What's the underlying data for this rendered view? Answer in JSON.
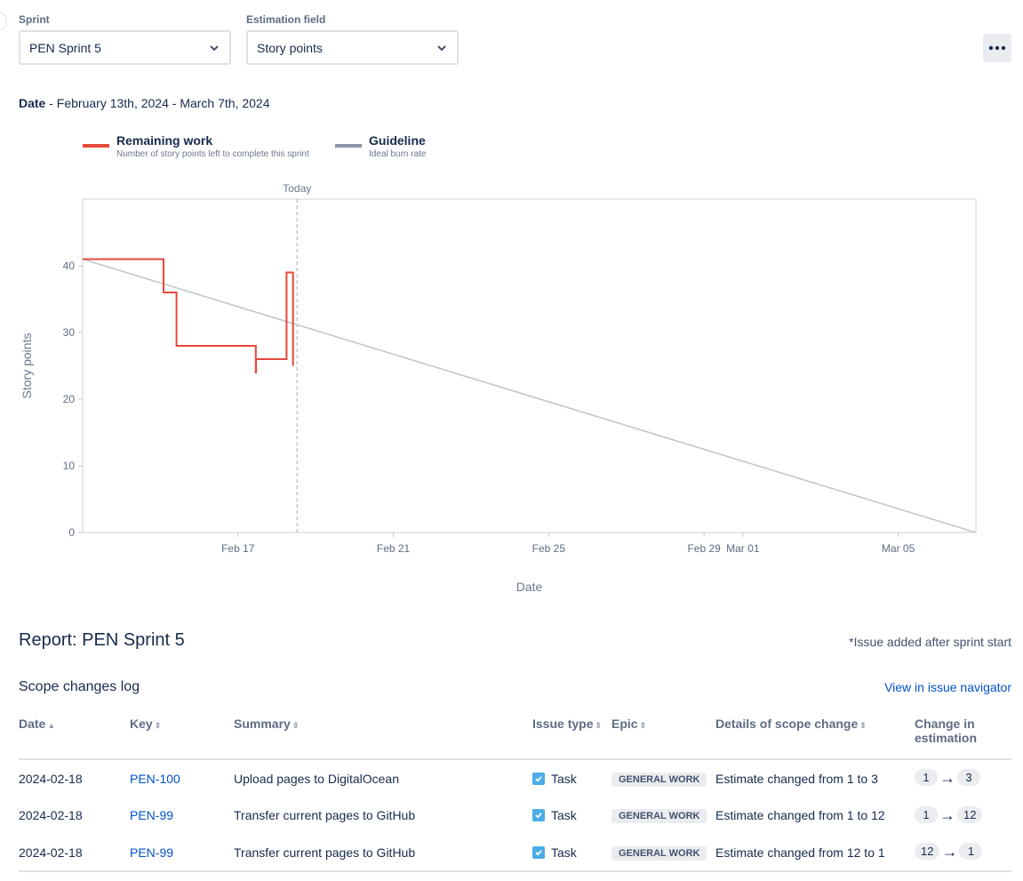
{
  "filters": {
    "sprint": {
      "label": "Sprint",
      "value": "PEN Sprint 5"
    },
    "estimation": {
      "label": "Estimation field",
      "value": "Story points"
    }
  },
  "date_range": {
    "label": "Date",
    "value": " - February 13th, 2024 - March 7th, 2024"
  },
  "legend": {
    "remaining": {
      "title": "Remaining work",
      "desc": "Number of story points left to complete this sprint",
      "color": "#e5493a"
    },
    "guideline": {
      "title": "Guideline",
      "desc": "Ideal burn rate",
      "color": "#8993a4"
    }
  },
  "chart_data": {
    "type": "line",
    "xlabel": "Date",
    "ylabel": "Story points",
    "ylim": [
      0,
      50
    ],
    "xlim": [
      "2024-02-13",
      "2024-03-07"
    ],
    "y_ticks": [
      0,
      10,
      20,
      30,
      40
    ],
    "x_ticks": [
      {
        "date": "2024-02-17",
        "label": "Feb 17"
      },
      {
        "date": "2024-02-21",
        "label": "Feb 21"
      },
      {
        "date": "2024-02-25",
        "label": "Feb 25"
      },
      {
        "date": "2024-02-29",
        "label": "Feb 29"
      },
      {
        "date": "2024-03-01",
        "label": "Mar 01"
      },
      {
        "date": "2024-03-05",
        "label": "Mar 05"
      }
    ],
    "today": {
      "date": "2024-02-18 12:30",
      "label": "Today"
    },
    "series": [
      {
        "name": "Remaining work",
        "color": "#e5493a",
        "step": true,
        "points": [
          {
            "x": "2024-02-13 00:00",
            "y": 41
          },
          {
            "x": "2024-02-15 02:00",
            "y": 36
          },
          {
            "x": "2024-02-15 10:00",
            "y": 28
          },
          {
            "x": "2024-02-17 11:00",
            "y": 24
          },
          {
            "x": "2024-02-17 11:10",
            "y": 26
          },
          {
            "x": "2024-02-18 06:00",
            "y": 39
          },
          {
            "x": "2024-02-18 10:00",
            "y": 25
          }
        ]
      },
      {
        "name": "Guideline",
        "color": "#c1c7d0",
        "step": false,
        "points": [
          {
            "x": "2024-02-13 00:00",
            "y": 41
          },
          {
            "x": "2024-03-07 00:00",
            "y": 0
          }
        ]
      }
    ]
  },
  "report": {
    "title": "Report: PEN Sprint 5",
    "footnote": "*Issue added after sprint start",
    "log_title": "Scope changes log",
    "nav_link": "View in issue navigator"
  },
  "table": {
    "headers": {
      "date": "Date",
      "key": "Key",
      "summary": "Summary",
      "type": "Issue type",
      "epic": "Epic",
      "details": "Details of scope change",
      "change": "Change in estimation"
    },
    "rows": [
      {
        "date": "2024-02-18",
        "key": "PEN-100",
        "summary": "Upload pages to DigitalOcean",
        "type": "Task",
        "epic": "GENERAL WORK",
        "details": "Estimate changed from 1 to 3",
        "from": "1",
        "to": "3"
      },
      {
        "date": "2024-02-18",
        "key": "PEN-99",
        "summary": "Transfer current pages to GitHub",
        "type": "Task",
        "epic": "GENERAL WORK",
        "details": "Estimate changed from 1 to 12",
        "from": "1",
        "to": "12"
      },
      {
        "date": "2024-02-18",
        "key": "PEN-99",
        "summary": "Transfer current pages to GitHub",
        "type": "Task",
        "epic": "GENERAL WORK",
        "details": "Estimate changed from 12 to 1",
        "from": "12",
        "to": "1"
      }
    ]
  }
}
